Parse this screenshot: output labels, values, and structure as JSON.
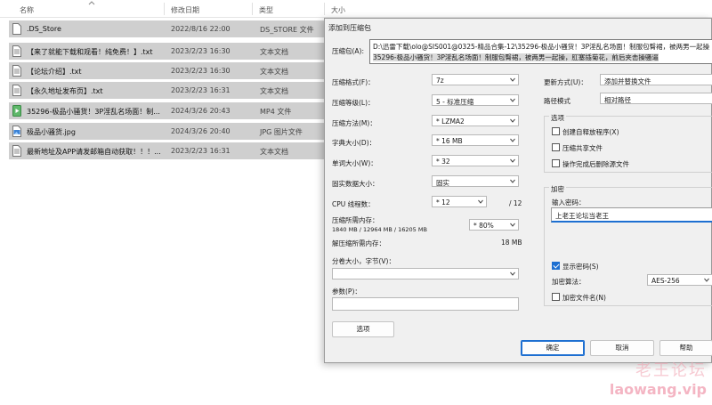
{
  "explorer": {
    "columns": {
      "name": "名称",
      "date": "修改日期",
      "type": "类型",
      "size": "大小"
    },
    "files": [
      {
        "name": ".DS_Store",
        "date": "2022/8/16 22:00",
        "type": "DS_STORE 文件",
        "icon": "generic-file-icon"
      },
      {
        "name": "【来了就能下载和观看！纯免费！】.txt",
        "date": "2023/2/23 16:30",
        "type": "文本文档",
        "icon": "text-file-icon"
      },
      {
        "name": "【论坛介绍】.txt",
        "date": "2023/2/23 16:30",
        "type": "文本文档",
        "icon": "text-file-icon"
      },
      {
        "name": "【永久地址发布页】.txt",
        "date": "2023/2/23 16:31",
        "type": "文本文档",
        "icon": "text-file-icon"
      },
      {
        "name": "35296-极品小骚货！3P淫乱名场面！制...",
        "date": "2024/3/26 20:43",
        "type": "MP4 文件",
        "icon": "video-file-icon"
      },
      {
        "name": "极品小骚货.jpg",
        "date": "2024/3/26 20:40",
        "type": "JPG 图片文件",
        "icon": "image-file-icon"
      },
      {
        "name": "最新地址及APP请发邮箱自动获取！！！...",
        "date": "2023/2/23 16:31",
        "type": "文本文档",
        "icon": "text-file-icon"
      }
    ]
  },
  "dialog": {
    "title": "添加到压缩包",
    "archive_label": "压缩包(A):",
    "archive_line1": "D:\\迅雷下载\\olo@SIS001@0325-精品合集-12\\35296-极品小骚货！3P淫乱名场面！制服包臀裙，被两男一起操",
    "archive_line2": "35296-极品小骚货！3P淫乱名场面！制服包臀裙，被两男一起操，肛塞插菊花，前后夹击操骚逼",
    "format_label": "压缩格式(F)：",
    "format_value": "7z",
    "level_label": "压缩等级(L)：",
    "level_value": "5 - 标准压缩",
    "method_label": "压缩方法(M)：",
    "method_value": "* LZMA2",
    "dict_label": "字典大小(D)：",
    "dict_value": "* 16 MB",
    "word_label": "单词大小(W)：",
    "word_value": "* 32",
    "solid_label": "固实数据大小：",
    "solid_value": "固实",
    "cpu_label": "CPU 线程数：",
    "cpu_value": "* 12",
    "cpu_total": "/ 12",
    "mem_label": "压缩所需内存：",
    "mem_detail": "1840 MB / 12964 MB / 16205 MB",
    "mem_value": "* 80%",
    "decomp_label": "解压缩所需内存：",
    "decomp_value": "18 MB",
    "volume_label": "分卷大小，字节(V)：",
    "volume_value": "",
    "params_label": "参数(P)：",
    "params_value": "",
    "options_button": "选项",
    "update_label": "更新方式(U)：",
    "update_value": "添加并替换文件",
    "pathmode_label": "路径模式",
    "pathmode_value": "相对路径",
    "options_group": "选项",
    "opt_sfx": "创建自释放程序(X)",
    "opt_shared": "压缩共享文件",
    "opt_delete": "操作完成后删除源文件",
    "encrypt_group": "加密",
    "password_label": "输入密码：",
    "password_value": "上老王论坛当老王",
    "show_password": "显示密码(S)",
    "enc_method_label": "加密算法：",
    "enc_method_value": "AES-256",
    "encrypt_names": "加密文件名(N)",
    "ok": "确定",
    "cancel": "取消",
    "help": "帮助"
  },
  "watermark": {
    "line1": "老王论坛",
    "line2": "laowang.vip"
  }
}
